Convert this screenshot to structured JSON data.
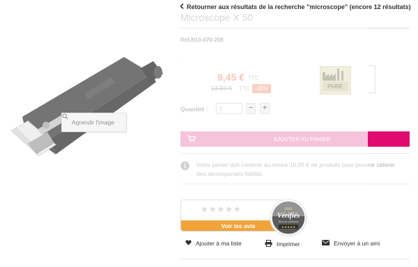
{
  "back_link": {
    "label": "Retourner aux résultats de la recherche \"microscope\" (encore 12 résultats)"
  },
  "product": {
    "title": "Microscope X 50",
    "reference": "Réf.N10-670-206",
    "price": "9,45 €",
    "price_tax": "TTC",
    "old_price": "13,50 €",
    "old_price_tax": "TTC",
    "discount": "-30%",
    "brand": "PURE",
    "image_tooltip": "Agrandir l'image",
    "image_icon": "magnifier-icon"
  },
  "quantity": {
    "label": "Quantité :",
    "value": "1",
    "minus": "−",
    "plus": "+"
  },
  "cart": {
    "button_label": "AJOUTER AU PANIER",
    "icon": "cart-icon",
    "accent": "#e10a6f"
  },
  "loyalty": {
    "text": "Votre panier doit contenir au moins 10,00 € de produits pour pouvoir obtenir des récompenses fidélité.",
    "icon": "info-icon"
  },
  "reviews": {
    "stars": "★★★★★",
    "rating": 0,
    "button_label": "Voir les avis",
    "accent": "#f0a43a",
    "badge_top": "Avis",
    "badge_main": "Vérifiés",
    "badge_sub": "Tiers de confiance",
    "badge_stars": "★★★★★"
  },
  "actions": [
    {
      "label": "Ajouter à ma liste",
      "icon": "heart-icon"
    },
    {
      "label": "Imprimer",
      "icon": "printer-icon"
    },
    {
      "label": "Envoyer à un ami",
      "icon": "envelope-icon"
    }
  ]
}
